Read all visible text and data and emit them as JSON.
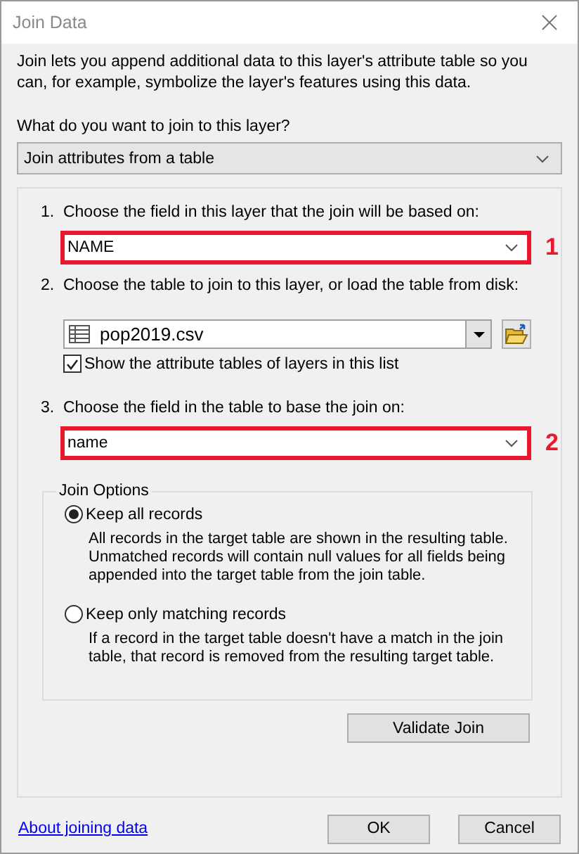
{
  "window": {
    "title": "Join Data"
  },
  "intro": "Join lets you append additional data to this layer's attribute table so you can, for example, symbolize the layer's features using this data.",
  "question": "What do you want to join to this layer?",
  "join_type": {
    "value": "Join attributes from a table"
  },
  "steps": [
    {
      "kind": "field",
      "number": "1.",
      "label": "Choose the field in this layer that the join will be based on:",
      "value": "NAME",
      "callout": "1"
    },
    {
      "kind": "table",
      "number": "2.",
      "label": "Choose the table to join to this layer, or load the table from disk:",
      "value": "pop2019.csv",
      "checkbox": {
        "label": "Show the attribute tables of layers in this list",
        "checked": true
      }
    },
    {
      "kind": "field",
      "number": "3.",
      "label": "Choose the field in the table to base the join on:",
      "value": "name",
      "callout": "2"
    }
  ],
  "join_options": {
    "title": "Join Options",
    "options": [
      {
        "label": "Keep all records",
        "description": "All records in the target table are shown in the resulting table. Unmatched records will contain null values for all fields being appended into the target table from the join table.",
        "selected": true
      },
      {
        "label": "Keep only matching records",
        "description": "If a record in the target table doesn't have a match in the join table, that record is removed from the resulting target table.",
        "selected": false
      }
    ]
  },
  "validate_button": "Validate Join",
  "help_link": "About joining data",
  "buttons": [
    "OK",
    "Cancel"
  ]
}
